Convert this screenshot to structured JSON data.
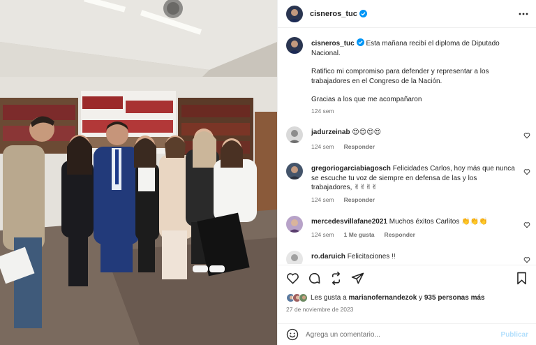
{
  "photo": {
    "alt_semantic": "group-photo"
  },
  "header": {
    "username": "cisneros_tuc",
    "verified_icon": "verified-badge-icon",
    "more_icon": "more-options-icon"
  },
  "caption": {
    "username": "cisneros_tuc",
    "line1": "Esta mañana recibí el diploma de Diputado Nacional.",
    "line2": "Ratifico mi compromiso para defender y representar a los trabajadores en el Congreso de la Nación.",
    "line3": "Gracias a los que me acompañaron",
    "time": "124 sem"
  },
  "comments": [
    {
      "username": "jadurzeinab",
      "text": "😍😍😍😍",
      "time": "124 sem",
      "likes": "",
      "reply": "Responder"
    },
    {
      "username": "gregoriogarciabiagosch",
      "text": "Felicidades Carlos, hoy más que nunca se escuche tu voz de siempre en defensa de las y los trabajadores, ✌✌✌✌",
      "time": "124 sem",
      "likes": "",
      "reply": "Responder"
    },
    {
      "username": "mercedesvillafane2021",
      "text": "Muchos éxitos Carlitos 👏👏👏",
      "time": "124 sem",
      "likes": "1 Me gusta",
      "reply": "Responder"
    },
    {
      "username": "ro.daruich",
      "text": "Felicitaciones !!",
      "time": "",
      "likes": "",
      "reply": ""
    }
  ],
  "actions": {
    "likes_prefix": "Les gusta a",
    "likes_user": "marianofernandezok",
    "likes_mid": "y",
    "likes_count": "935 personas más",
    "date": "27 de noviembre de 2023"
  },
  "add_comment": {
    "placeholder": "Agrega un comentario...",
    "publish": "Publicar"
  },
  "colors": {
    "link_blue": "#0095f6",
    "publish_disabled": "#b2dffc",
    "muted": "#737373"
  }
}
